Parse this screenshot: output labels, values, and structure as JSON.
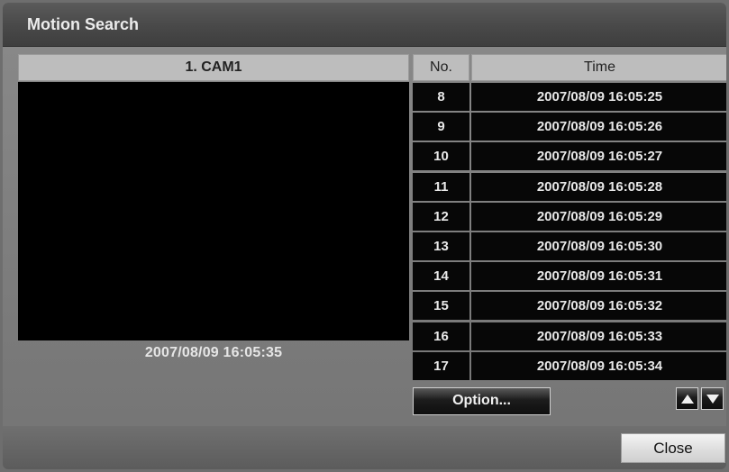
{
  "window": {
    "title": "Motion Search"
  },
  "camera": {
    "label": "1. CAM1",
    "timestamp": "2007/08/09  16:05:35"
  },
  "table": {
    "headers": {
      "no": "No.",
      "time": "Time"
    },
    "rows": [
      {
        "no": "8",
        "time": "2007/08/09  16:05:25"
      },
      {
        "no": "9",
        "time": "2007/08/09  16:05:26"
      },
      {
        "no": "10",
        "time": "2007/08/09  16:05:27"
      },
      {
        "no": "11",
        "time": "2007/08/09  16:05:28"
      },
      {
        "no": "12",
        "time": "2007/08/09  16:05:29"
      },
      {
        "no": "13",
        "time": "2007/08/09  16:05:30"
      },
      {
        "no": "14",
        "time": "2007/08/09  16:05:31"
      },
      {
        "no": "15",
        "time": "2007/08/09  16:05:32"
      },
      {
        "no": "16",
        "time": "2007/08/09  16:05:33"
      },
      {
        "no": "17",
        "time": "2007/08/09  16:05:34"
      }
    ]
  },
  "buttons": {
    "option": "Option...",
    "close": "Close"
  },
  "icons": {
    "scroll_up": "arrow-up-icon",
    "scroll_down": "arrow-down-icon"
  }
}
